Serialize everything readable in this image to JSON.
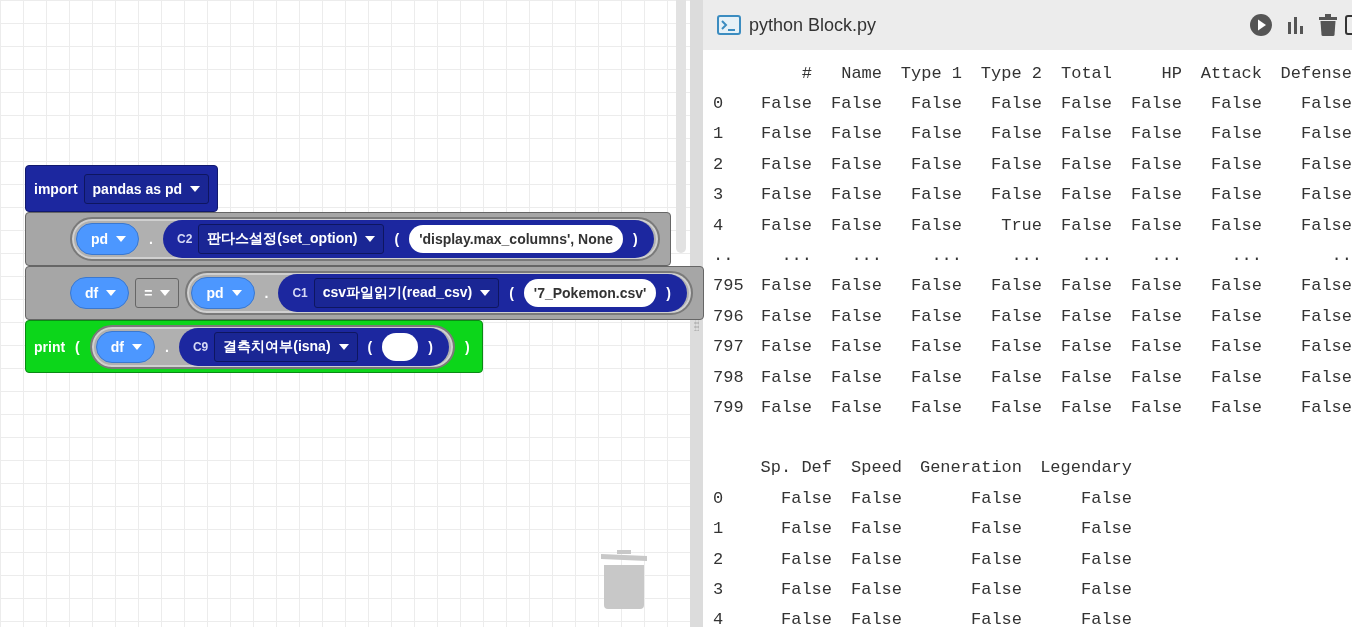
{
  "workspace": {
    "blocks": [
      {
        "kind": "import",
        "parts": [
          {
            "kind": "keyword",
            "text": "import"
          },
          {
            "kind": "dropdown",
            "text": "pandas as pd"
          }
        ]
      },
      {
        "kind": "statement",
        "parts": [
          {
            "kind": "group",
            "children": [
              {
                "kind": "var",
                "text": "pd"
              },
              {
                "kind": "dot",
                "text": "."
              },
              {
                "kind": "method",
                "children": [
                  {
                    "kind": "label",
                    "text": "C2"
                  },
                  {
                    "kind": "dropdown",
                    "text": "판다스설정(set_option)"
                  },
                  {
                    "kind": "paren",
                    "text": "("
                  },
                  {
                    "kind": "string",
                    "text": "'display.max_columns', None"
                  },
                  {
                    "kind": "paren",
                    "text": ")"
                  }
                ]
              }
            ]
          }
        ]
      },
      {
        "kind": "statement",
        "parts": [
          {
            "kind": "var",
            "text": "df"
          },
          {
            "kind": "op",
            "text": "="
          },
          {
            "kind": "group",
            "children": [
              {
                "kind": "var",
                "text": "pd"
              },
              {
                "kind": "dot",
                "text": "."
              },
              {
                "kind": "method",
                "children": [
                  {
                    "kind": "label",
                    "text": "C1"
                  },
                  {
                    "kind": "dropdown",
                    "text": "csv파일읽기(read_csv)"
                  },
                  {
                    "kind": "paren",
                    "text": "("
                  },
                  {
                    "kind": "string",
                    "text": "'7_Pokemon.csv'"
                  },
                  {
                    "kind": "paren",
                    "text": ")"
                  }
                ]
              }
            ]
          }
        ]
      },
      {
        "kind": "print",
        "parts": [
          {
            "kind": "keyword",
            "text": "print"
          },
          {
            "kind": "paren",
            "text": "("
          },
          {
            "kind": "group",
            "children": [
              {
                "kind": "var",
                "text": "df"
              },
              {
                "kind": "dot",
                "text": "."
              },
              {
                "kind": "method",
                "children": [
                  {
                    "kind": "label",
                    "text": "C9"
                  },
                  {
                    "kind": "dropdown",
                    "text": "결측치여부(isna)"
                  },
                  {
                    "kind": "paren",
                    "text": "("
                  },
                  {
                    "kind": "string"
                  },
                  {
                    "kind": "paren",
                    "text": ")"
                  }
                ]
              }
            ]
          },
          {
            "kind": "paren",
            "text": ")"
          }
        ]
      }
    ]
  },
  "console": {
    "title": "python Block.py",
    "tables": [
      {
        "columns": [
          "#",
          "Name",
          "Type 1",
          "Type 2",
          "Total",
          "HP",
          "Attack",
          "Defense"
        ],
        "rows": [
          {
            "index": "0",
            "cells": [
              "False",
              "False",
              "False",
              "False",
              "False",
              "False",
              "False",
              "False"
            ]
          },
          {
            "index": "1",
            "cells": [
              "False",
              "False",
              "False",
              "False",
              "False",
              "False",
              "False",
              "False"
            ]
          },
          {
            "index": "2",
            "cells": [
              "False",
              "False",
              "False",
              "False",
              "False",
              "False",
              "False",
              "False"
            ]
          },
          {
            "index": "3",
            "cells": [
              "False",
              "False",
              "False",
              "False",
              "False",
              "False",
              "False",
              "False"
            ]
          },
          {
            "index": "4",
            "cells": [
              "False",
              "False",
              "False",
              "True",
              "False",
              "False",
              "False",
              "False"
            ]
          },
          {
            "index": "..",
            "cells": [
              "...",
              "...",
              "...",
              "...",
              "...",
              "...",
              "...",
              ".."
            ]
          },
          {
            "index": "795",
            "cells": [
              "False",
              "False",
              "False",
              "False",
              "False",
              "False",
              "False",
              "False"
            ]
          },
          {
            "index": "796",
            "cells": [
              "False",
              "False",
              "False",
              "False",
              "False",
              "False",
              "False",
              "False"
            ]
          },
          {
            "index": "797",
            "cells": [
              "False",
              "False",
              "False",
              "False",
              "False",
              "False",
              "False",
              "False"
            ]
          },
          {
            "index": "798",
            "cells": [
              "False",
              "False",
              "False",
              "False",
              "False",
              "False",
              "False",
              "False"
            ]
          },
          {
            "index": "799",
            "cells": [
              "False",
              "False",
              "False",
              "False",
              "False",
              "False",
              "False",
              "False"
            ]
          }
        ]
      },
      {
        "columns": [
          "Sp. Def",
          "Speed",
          "Generation",
          "Legendary"
        ],
        "rows": [
          {
            "index": "0",
            "cells": [
              "False",
              "False",
              "False",
              "False"
            ]
          },
          {
            "index": "1",
            "cells": [
              "False",
              "False",
              "False",
              "False"
            ]
          },
          {
            "index": "2",
            "cells": [
              "False",
              "False",
              "False",
              "False"
            ]
          },
          {
            "index": "3",
            "cells": [
              "False",
              "False",
              "False",
              "False"
            ]
          },
          {
            "index": "4",
            "cells": [
              "False",
              "False",
              "False",
              "False"
            ]
          }
        ]
      }
    ]
  }
}
